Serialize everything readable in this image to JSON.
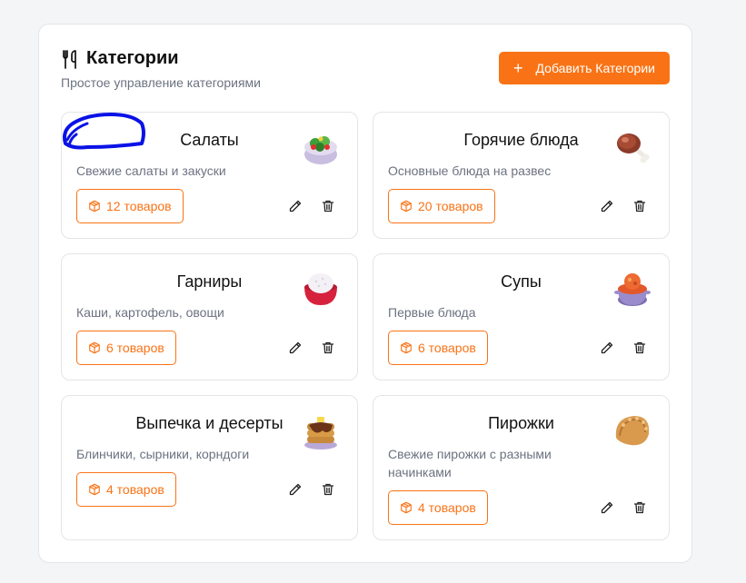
{
  "header": {
    "title": "Категории",
    "subtitle": "Простое управление категориями",
    "add_button_label": "Добавить Категории",
    "title_icon": "utensils-icon"
  },
  "colors": {
    "accent": "#f97316",
    "muted_text": "#6b7280",
    "border": "#e3e5e8",
    "annotation_scribble": "#0a12e6"
  },
  "categories": [
    {
      "name": "Салаты",
      "description": "Свежие салаты и закуски",
      "count_label": "12 товаров",
      "icon": "salad-bowl-icon"
    },
    {
      "name": "Горячие блюда",
      "description": "Основные блюда на развес",
      "count_label": "20 товаров",
      "icon": "meat-on-bone-icon"
    },
    {
      "name": "Гарниры",
      "description": "Каши, картофель, овощи",
      "count_label": "6 товаров",
      "icon": "rice-bowl-icon"
    },
    {
      "name": "Супы",
      "description": "Первые блюда",
      "count_label": "6 товаров",
      "icon": "soup-pot-icon"
    },
    {
      "name": "Выпечка и десерты",
      "description": "Блинчики, сырники, корндоги",
      "count_label": "4 товаров",
      "icon": "pancakes-icon"
    },
    {
      "name": "Пирожки",
      "description": "Свежие пирожки с разными начинками",
      "count_label": "4 товаров",
      "icon": "dumpling-icon"
    }
  ]
}
